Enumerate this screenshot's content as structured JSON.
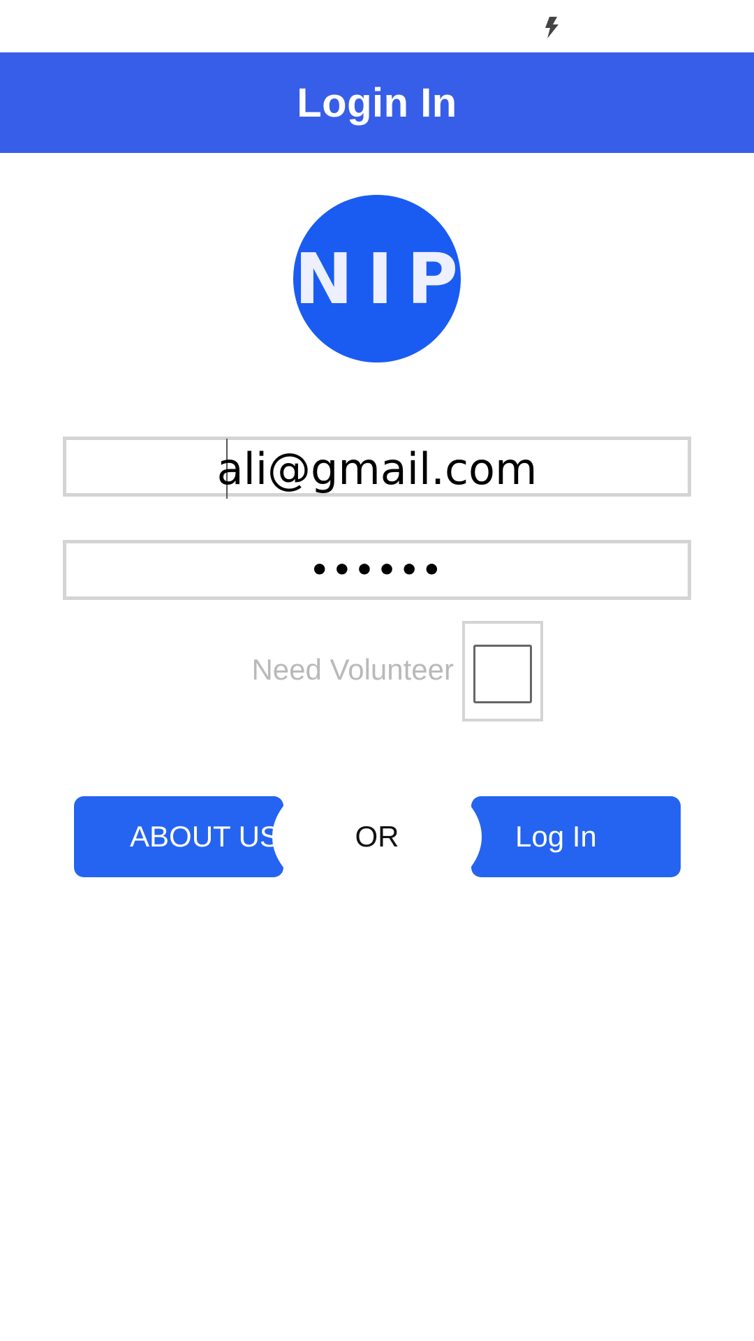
{
  "status_bar": {
    "icon": "flash-icon"
  },
  "app_bar": {
    "title": "Login In",
    "background": "#375ee8"
  },
  "logo": {
    "text": "NIP",
    "color": "#1a5cf2"
  },
  "form": {
    "email_value": "ali@gmail.com",
    "password_value": "••••••",
    "volunteer_label": "Need Volunteer",
    "volunteer_checked": false
  },
  "buttons": {
    "about_label": "ABOUT US",
    "or_label": "OR",
    "login_label": "Log In",
    "color": "#2564f0"
  }
}
